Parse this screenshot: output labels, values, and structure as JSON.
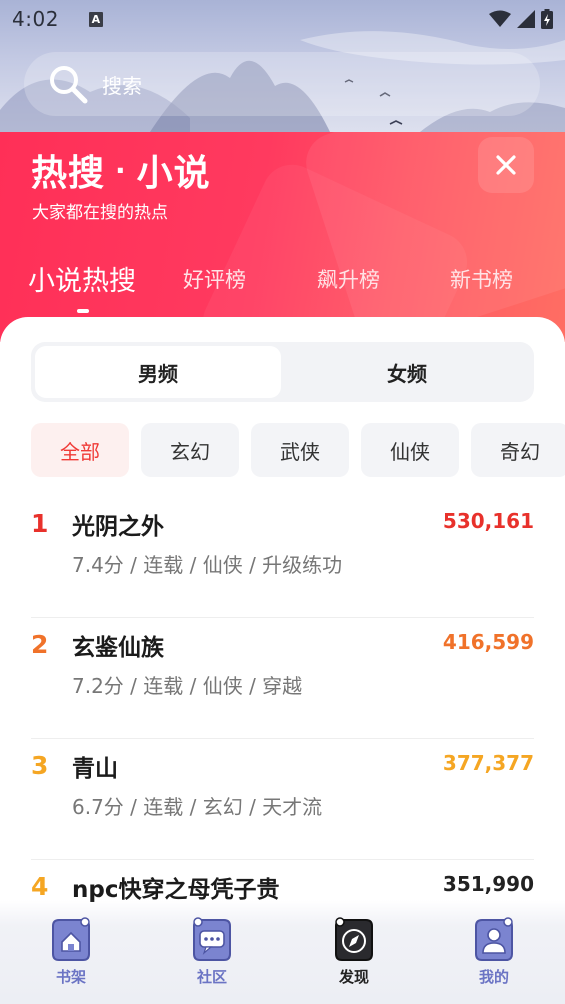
{
  "status_bar": {
    "time": "4:02",
    "notification_icon": "a-app-icon",
    "wifi_icon": "wifi-icon",
    "signal_icon": "signal-icon",
    "battery_icon": "battery-charging-icon"
  },
  "search": {
    "placeholder": "搜索"
  },
  "hot": {
    "title_main": "热搜",
    "title_dot": "·",
    "title_sub": "小说",
    "subtitle": "大家都在搜的热点",
    "close_icon": "close-icon"
  },
  "rank_tabs": [
    {
      "label": "小说热搜",
      "active": true
    },
    {
      "label": "好评榜",
      "active": false
    },
    {
      "label": "飙升榜",
      "active": false
    },
    {
      "label": "新书榜",
      "active": false
    }
  ],
  "gender_toggle": [
    {
      "label": "男频",
      "active": true
    },
    {
      "label": "女频",
      "active": false
    }
  ],
  "genres": [
    {
      "label": "全部",
      "active": true
    },
    {
      "label": "玄幻",
      "active": false
    },
    {
      "label": "武侠",
      "active": false
    },
    {
      "label": "仙侠",
      "active": false
    },
    {
      "label": "奇幻",
      "active": false
    }
  ],
  "books": [
    {
      "rank": "1",
      "title": "光阴之外",
      "meta": "7.4分 / 连载 / 仙侠 / 升级练功",
      "heat": "530,161",
      "color": "#e8312b"
    },
    {
      "rank": "2",
      "title": "玄鉴仙族",
      "meta": "7.2分 / 连载 / 仙侠 / 穿越",
      "heat": "416,599",
      "color": "#f0722a"
    },
    {
      "rank": "3",
      "title": "青山",
      "meta": "6.7分 / 连载 / 玄幻 / 天才流",
      "heat": "377,377",
      "color": "#f5a623"
    },
    {
      "rank": "4",
      "title": "npc快穿之母凭子贵",
      "meta": "",
      "heat": "351,990",
      "color": "#f5a623"
    }
  ],
  "bottom_nav": [
    {
      "label": "书架",
      "icon": "bookshelf-home-icon",
      "active": false
    },
    {
      "label": "社区",
      "icon": "community-chat-icon",
      "active": false
    },
    {
      "label": "发现",
      "icon": "discover-compass-icon",
      "active": true
    },
    {
      "label": "我的",
      "icon": "profile-user-icon",
      "active": false
    }
  ],
  "colors": {
    "header_red": "#ff3a5f",
    "rank1": "#e8312b",
    "rank2": "#f0722a",
    "rank3": "#f5a623",
    "nav_blue": "#6b74c4"
  }
}
